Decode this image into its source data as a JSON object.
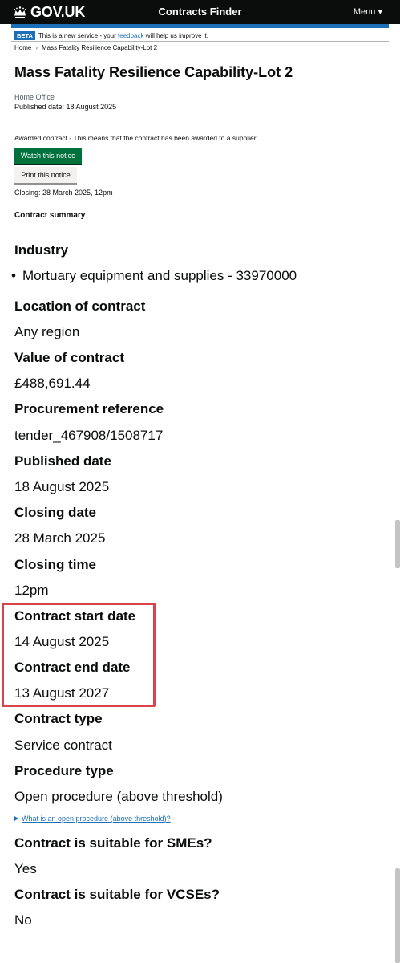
{
  "header": {
    "logo_text": "GOV.UK",
    "service_name": "Contracts Finder",
    "menu_label": "Menu",
    "menu_icon": "caret-down-icon",
    "brand_color": "#1d70b8"
  },
  "phase_banner": {
    "tag": "BETA",
    "text_before": "This is a new service - your",
    "link": "feedback",
    "text_after": "will help us improve it."
  },
  "breadcrumb": {
    "home": "Home",
    "current": "Mass Fatality Resilience Capability-Lot 2"
  },
  "notice": {
    "title": "Mass Fatality Resilience Capability-Lot 2",
    "organisation": "Home Office",
    "published_line": "Published date: 18 August 2025",
    "awarded_text": "Awarded contract - This means that the contract has been awarded to a supplier.",
    "watch_button": "Watch this notice",
    "print_button": "Print this notice",
    "closing_line": "Closing: 28 March 2025, 12pm",
    "summary_heading": "Contract summary"
  },
  "fields": {
    "industry_label": "Industry",
    "industry_value": "Mortuary equipment and supplies - 33970000",
    "location_label": "Location of contract",
    "location_value": "Any region",
    "value_label": "Value of contract",
    "value_value": "£488,691.44",
    "reference_label": "Procurement reference",
    "reference_value": "tender_467908/1508717",
    "published_label": "Published date",
    "published_value": "18 August 2025",
    "closing_date_label": "Closing date",
    "closing_date_value": "28 March 2025",
    "closing_time_label": "Closing time",
    "closing_time_value": "12pm",
    "start_label": "Contract start date",
    "start_value": "14 August 2025",
    "end_label": "Contract end date",
    "end_value": "13 August 2027",
    "type_label": "Contract type",
    "type_value": "Service contract",
    "procedure_label": "Procedure type",
    "procedure_value": "Open procedure (above threshold)",
    "procedure_details": "What is an open procedure (above threshold)?",
    "sme_label": "Contract is suitable for SMEs?",
    "sme_value": "Yes",
    "vcse_label": "Contract is suitable for VCSEs?",
    "vcse_value": "No"
  },
  "colors": {
    "green_button": "#00703c",
    "link": "#1d70b8",
    "highlight_border": "#d9434a"
  }
}
